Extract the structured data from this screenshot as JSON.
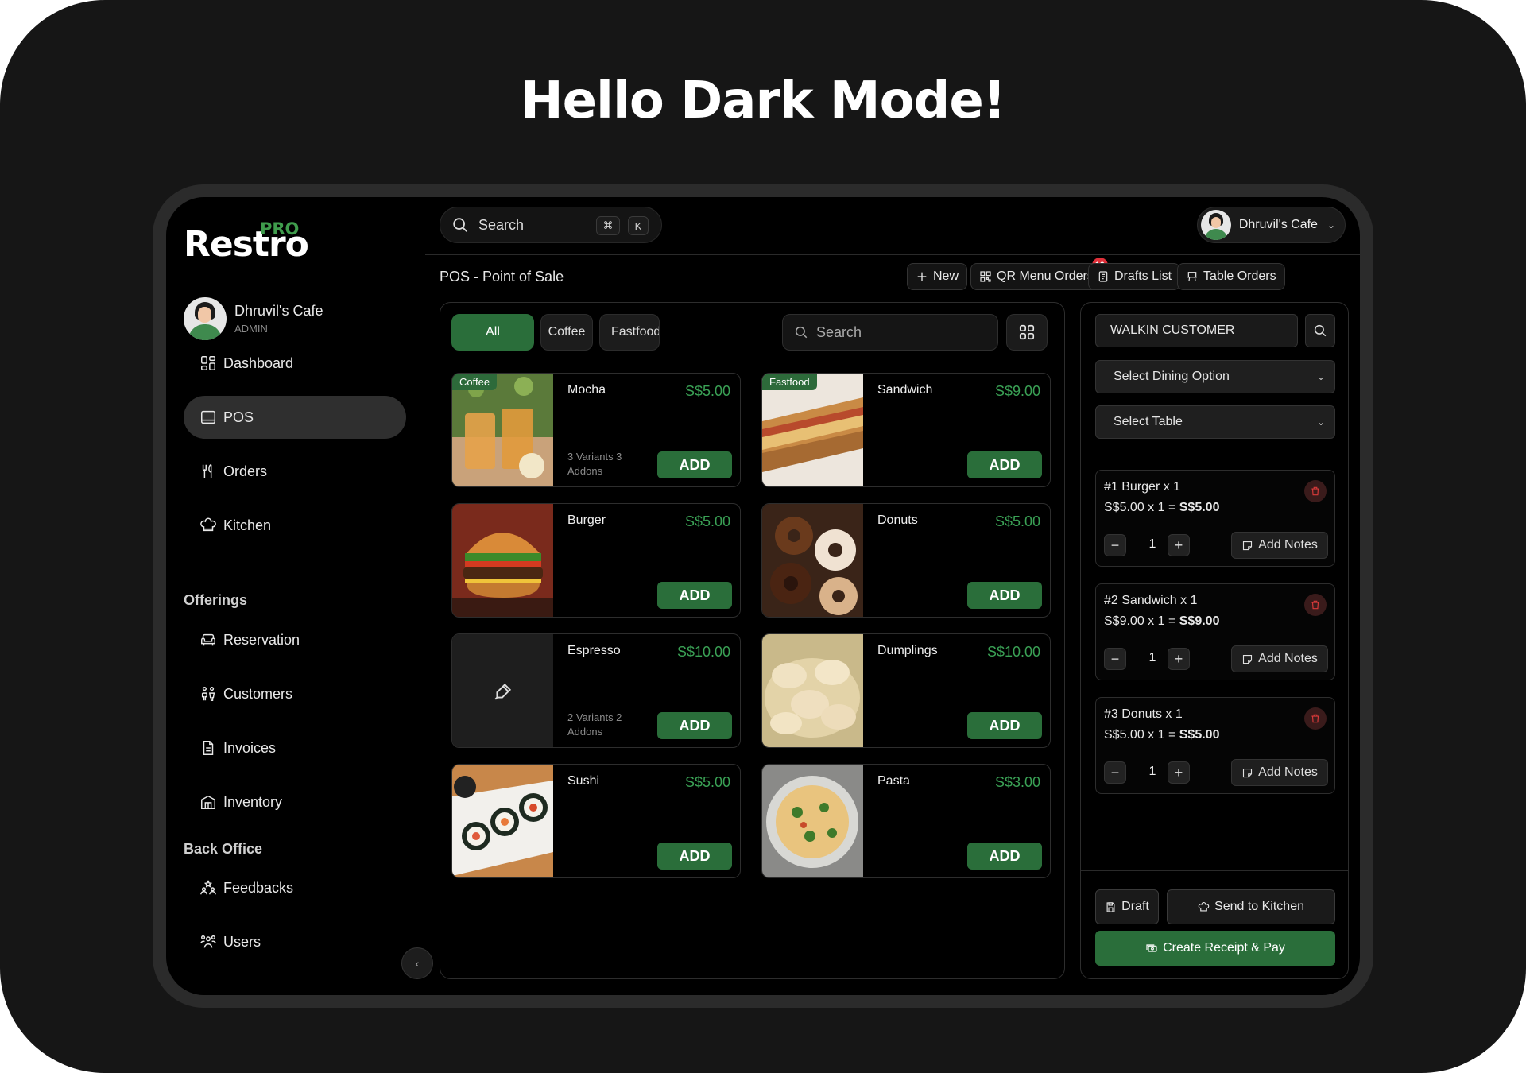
{
  "headline": "Hello Dark Mode!",
  "brand": {
    "name": "Restro",
    "badge": "PRO"
  },
  "profile": {
    "name": "Dhruvil's Cafe",
    "role": "ADMIN"
  },
  "nav": {
    "items": [
      {
        "label": "Dashboard",
        "icon": "dashboard-icon"
      },
      {
        "label": "POS",
        "icon": "pos-icon",
        "active": true
      },
      {
        "label": "Orders",
        "icon": "cutlery-icon"
      },
      {
        "label": "Kitchen",
        "icon": "chef-hat-icon"
      }
    ],
    "offerings_label": "Offerings",
    "offerings": [
      {
        "label": "Reservation",
        "icon": "sofa-icon"
      },
      {
        "label": "Customers",
        "icon": "customers-icon"
      },
      {
        "label": "Invoices",
        "icon": "invoice-icon"
      },
      {
        "label": "Inventory",
        "icon": "warehouse-icon"
      }
    ],
    "backoffice_label": "Back Office",
    "backoffice": [
      {
        "label": "Feedbacks",
        "icon": "stars-people-icon"
      },
      {
        "label": "Users",
        "icon": "users-icon"
      }
    ]
  },
  "topbar": {
    "search_placeholder": "Search",
    "shortcut_cmd": "⌘",
    "shortcut_key": "K",
    "user_name": "Dhruvil's Cafe"
  },
  "page": {
    "title": "POS - Point of Sale",
    "buttons": {
      "new": "New",
      "qr": "QR Menu Orders",
      "qr_badge": "10",
      "drafts": "Drafts List",
      "tables": "Table Orders"
    }
  },
  "products": {
    "categories": [
      "All",
      "Coffee",
      "Fastfood"
    ],
    "search_placeholder": "Search",
    "add_label": "ADD",
    "items": [
      {
        "name": "Mocha",
        "price": "S$5.00",
        "tag": "Coffee",
        "meta": "3 Variants 3 Addons"
      },
      {
        "name": "Sandwich",
        "price": "S$9.00",
        "tag": "Fastfood",
        "meta": ""
      },
      {
        "name": "Burger",
        "price": "S$5.00",
        "tag": "",
        "meta": ""
      },
      {
        "name": "Donuts",
        "price": "S$5.00",
        "tag": "",
        "meta": ""
      },
      {
        "name": "Espresso",
        "price": "S$10.00",
        "tag": "",
        "meta": "2 Variants 2 Addons"
      },
      {
        "name": "Dumplings",
        "price": "S$10.00",
        "tag": "",
        "meta": ""
      },
      {
        "name": "Sushi",
        "price": "S$5.00",
        "tag": "",
        "meta": ""
      },
      {
        "name": "Pasta",
        "price": "S$3.00",
        "tag": "",
        "meta": ""
      }
    ]
  },
  "cart": {
    "customer": "WALKIN CUSTOMER",
    "dining_option": "Select Dining Option",
    "table": "Select Table",
    "notes_label": "Add Notes",
    "items": [
      {
        "title": "#1 Burger x 1",
        "calc": "S$5.00 x 1 =",
        "total": "S$5.00",
        "qty": "1"
      },
      {
        "title": "#2 Sandwich x 1",
        "calc": "S$9.00 x 1 =",
        "total": "S$9.00",
        "qty": "1"
      },
      {
        "title": "#3 Donuts x 1",
        "calc": "S$5.00 x 1 =",
        "total": "S$5.00",
        "qty": "1"
      }
    ],
    "draft": "Draft",
    "kitchen": "Send to Kitchen",
    "pay": "Create Receipt & Pay"
  }
}
